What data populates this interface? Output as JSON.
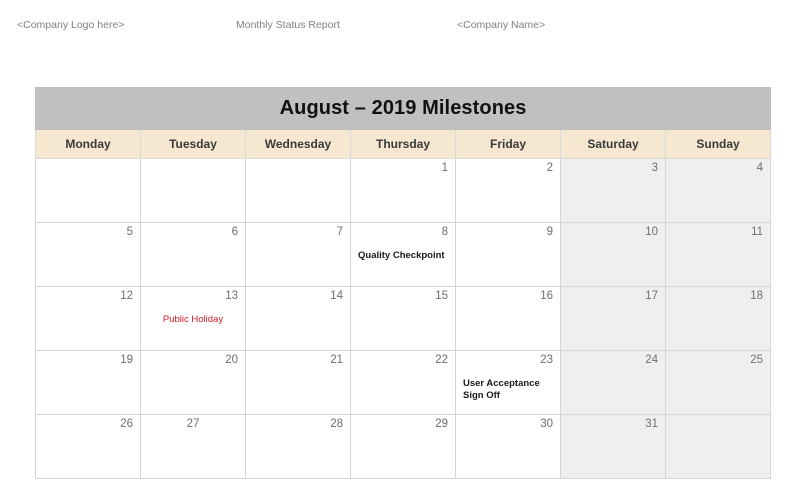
{
  "page_header": {
    "left": "<Company Logo here>",
    "center": "Monthly Status Report",
    "right": "<Company Name>"
  },
  "calendar": {
    "title": "August – 2019 Milestones",
    "title_bg": "#c0c0c0",
    "header_bg": "#f5e7d0",
    "weekend_bg": "#efefef",
    "holiday_color": "#cc2027",
    "day_headers": [
      "Monday",
      "Tuesday",
      "Wednesday",
      "Thursday",
      "Friday",
      "Saturday",
      "Sunday"
    ],
    "weeks": [
      {
        "days": [
          {
            "num": "",
            "event": "",
            "weekend": false
          },
          {
            "num": "",
            "event": "",
            "weekend": false
          },
          {
            "num": "",
            "event": "",
            "weekend": false
          },
          {
            "num": "1",
            "event": "",
            "weekend": false
          },
          {
            "num": "2",
            "event": "",
            "weekend": false
          },
          {
            "num": "3",
            "event": "",
            "weekend": true
          },
          {
            "num": "4",
            "event": "",
            "weekend": true
          }
        ]
      },
      {
        "days": [
          {
            "num": "5",
            "event": "",
            "weekend": false
          },
          {
            "num": "6",
            "event": "",
            "weekend": false
          },
          {
            "num": "7",
            "event": "",
            "weekend": false
          },
          {
            "num": "8",
            "event": "Quality Checkpoint",
            "event_style": "milestone",
            "weekend": false
          },
          {
            "num": "9",
            "event": "",
            "weekend": false
          },
          {
            "num": "10",
            "event": "",
            "weekend": true
          },
          {
            "num": "11",
            "event": "",
            "weekend": true
          }
        ]
      },
      {
        "days": [
          {
            "num": "12",
            "event": "",
            "weekend": false
          },
          {
            "num": "13",
            "event": "Public Holiday",
            "event_style": "holiday",
            "weekend": false
          },
          {
            "num": "14",
            "event": "",
            "weekend": false
          },
          {
            "num": "15",
            "event": "",
            "weekend": false
          },
          {
            "num": "16",
            "event": "",
            "weekend": false
          },
          {
            "num": "17",
            "event": "",
            "weekend": true
          },
          {
            "num": "18",
            "event": "",
            "weekend": true
          }
        ]
      },
      {
        "days": [
          {
            "num": "19",
            "event": "",
            "weekend": false
          },
          {
            "num": "20",
            "event": "",
            "weekend": false
          },
          {
            "num": "21",
            "event": "",
            "weekend": false
          },
          {
            "num": "22",
            "event": "",
            "weekend": false
          },
          {
            "num": "23",
            "event": "User Acceptance Sign Off",
            "event_style": "milestone",
            "weekend": false
          },
          {
            "num": "24",
            "event": "",
            "weekend": true
          },
          {
            "num": "25",
            "event": "",
            "weekend": true
          }
        ]
      },
      {
        "days": [
          {
            "num": "26",
            "event": "",
            "weekend": false
          },
          {
            "num": "27",
            "event": "",
            "weekend": false,
            "num_align": "center"
          },
          {
            "num": "28",
            "event": "",
            "weekend": false
          },
          {
            "num": "29",
            "event": "",
            "weekend": false
          },
          {
            "num": "30",
            "event": "",
            "weekend": false
          },
          {
            "num": "31",
            "event": "",
            "weekend": true
          },
          {
            "num": "",
            "event": "",
            "weekend": true
          }
        ]
      }
    ]
  }
}
